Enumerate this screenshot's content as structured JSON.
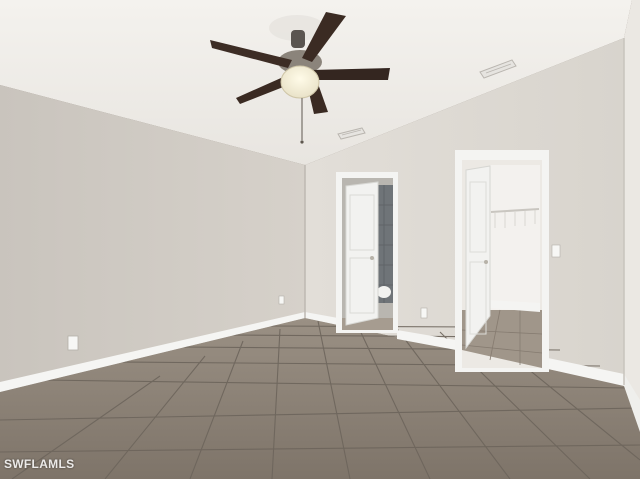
{
  "photo": {
    "watermark": "SWFLAMLS"
  },
  "colors": {
    "ceiling": "#f1efeb",
    "left_wall": "#cfcac3",
    "right_wall": "#dfdbd4",
    "floor_tile": "#8d8377",
    "grout": "#6e665d",
    "baseboard": "#f6f6f4",
    "door": "#f3f3f1",
    "fan_blade": "#3a2a22"
  }
}
